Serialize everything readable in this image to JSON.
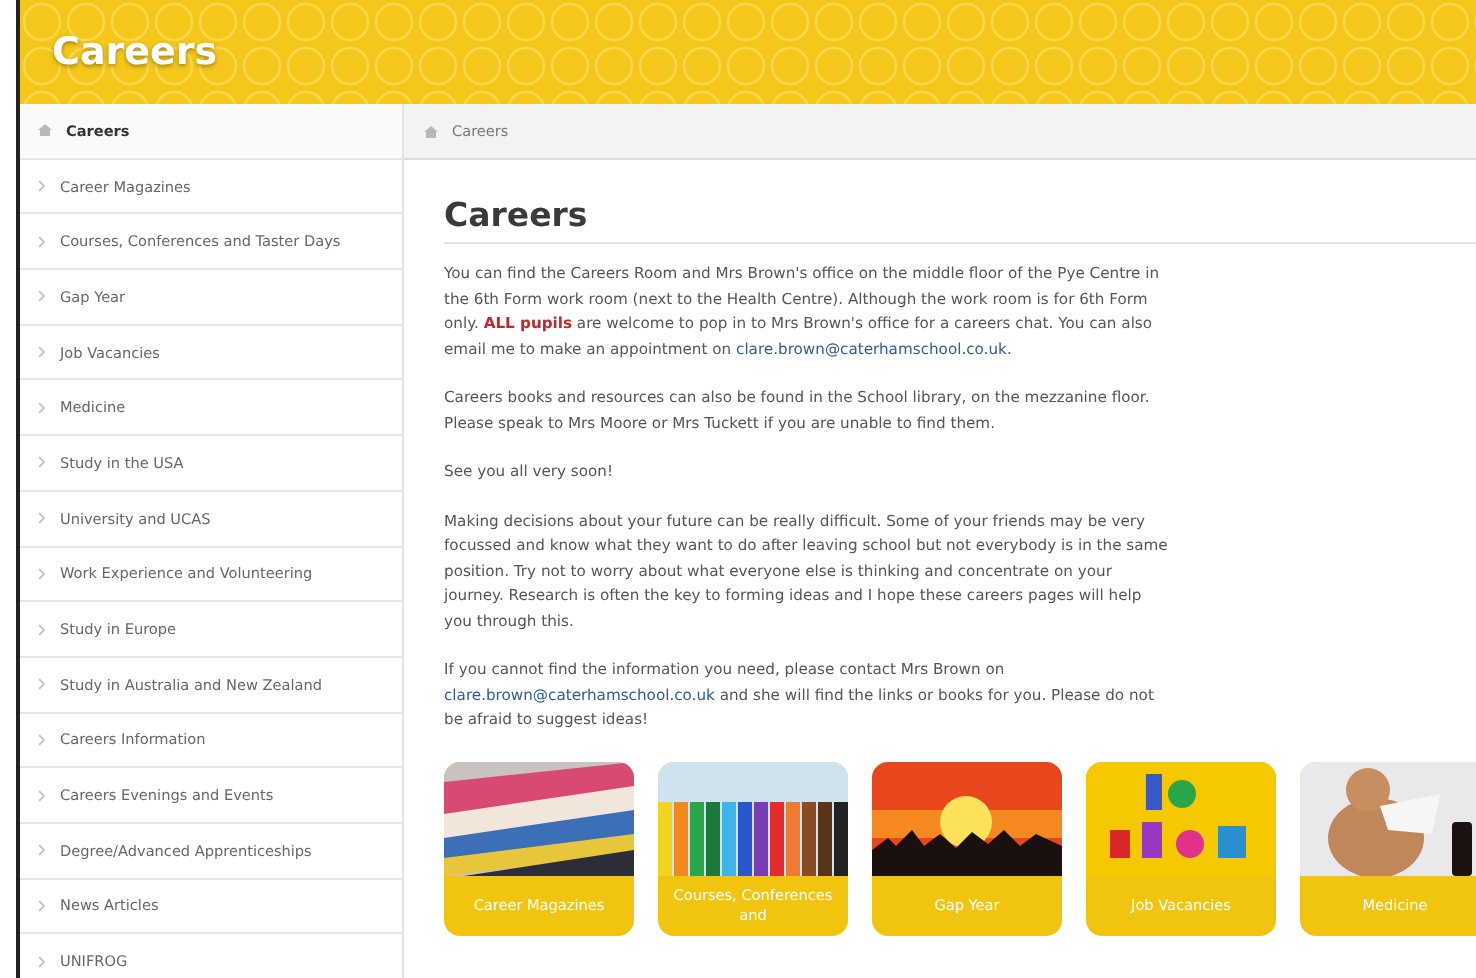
{
  "header": {
    "title": "Careers"
  },
  "sidebar": {
    "items": [
      {
        "label": "Careers",
        "kind": "home",
        "selected": true
      },
      {
        "label": "Career Magazines",
        "kind": "link",
        "selected": false
      },
      {
        "label": "Courses, Conferences and Taster Days",
        "kind": "link",
        "selected": false
      },
      {
        "label": "Gap Year",
        "kind": "link",
        "selected": false
      },
      {
        "label": "Job Vacancies",
        "kind": "link",
        "selected": false
      },
      {
        "label": "Medicine",
        "kind": "link",
        "selected": false
      },
      {
        "label": "Study in the USA",
        "kind": "link",
        "selected": false
      },
      {
        "label": "University and UCAS",
        "kind": "link",
        "selected": false
      },
      {
        "label": "Work Experience and Volunteering",
        "kind": "link",
        "selected": false
      },
      {
        "label": "Study in Europe",
        "kind": "link",
        "selected": false
      },
      {
        "label": "Study in Australia and New Zealand",
        "kind": "link",
        "selected": false
      },
      {
        "label": "Careers Information",
        "kind": "link",
        "selected": false
      },
      {
        "label": "Careers Evenings and Events",
        "kind": "link",
        "selected": false
      },
      {
        "label": "Degree/Advanced Apprenticeships",
        "kind": "link",
        "selected": false
      },
      {
        "label": "News Articles",
        "kind": "link",
        "selected": false
      },
      {
        "label": "UNIFROG",
        "kind": "link",
        "selected": false
      }
    ]
  },
  "breadcrumb": {
    "label": "Careers"
  },
  "page_title": "Careers",
  "paragraphs": [
    {
      "parts": [
        {
          "kind": "text",
          "text": "You can find the Careers Room and Mrs Brown's office on the middle floor of the Pye Centre in the 6th Form work room (next to the Health Centre). Although the work room is for 6th Form only. **ALL pupils** are welcome to pop in to Mrs Brown's office for a careers chat. You can also email me to make an appointment on "
        },
        {
          "kind": "link",
          "text": "clare.brown@caterhamschool.co.uk"
        },
        {
          "kind": "text",
          "text": "."
        }
      ]
    },
    {
      "parts": [
        {
          "kind": "text",
          "text": "Careers books and resources can also be found in the School library, on the mezzanine floor. Please speak to Mrs Moore or Mrs Tuckett if you are unable to find them."
        }
      ]
    },
    {
      "parts": [
        {
          "kind": "text",
          "text": "See you all very soon!"
        }
      ]
    },
    {
      "parts": [
        {
          "kind": "text",
          "text": "Making decisions about your future can be really difficult. Some of your friends may be very focussed and know what they want to do after leaving school but not everybody is in the same position. Try not to worry about what everyone else is thinking and concentrate on your journey. Research is often the key to forming ideas and I hope these careers pages will help you through this."
        }
      ]
    },
    {
      "parts": [
        {
          "kind": "text",
          "text": "If you cannot find the information you need, please contact Mrs Brown on "
        },
        {
          "kind": "link",
          "text": "clare.brown@caterhamschool.co.uk"
        },
        {
          "kind": "text",
          "text": " and she will find the links or books for you. Please do not be afraid to suggest ideas!"
        }
      ]
    }
  ],
  "tiles": [
    {
      "caption": "Career Magazines",
      "kind": "picture"
    },
    {
      "caption": "Courses, Conferences and",
      "kind": "picture"
    },
    {
      "caption": "Gap Year",
      "kind": "picture"
    },
    {
      "caption": "Job Vacancies",
      "kind": "picture"
    },
    {
      "caption": "Medicine",
      "kind": "picture"
    }
  ]
}
